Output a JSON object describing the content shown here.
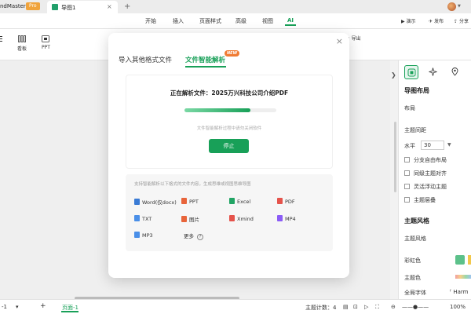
{
  "titlebar": {
    "app_name": "ndMaster",
    "pro_badge": "Pro",
    "doc_tab": "导图1",
    "doc_close": "×",
    "new_tab": "+"
  },
  "menubar": {
    "items": [
      "开始",
      "插入",
      "页面样式",
      "高级",
      "视图",
      "AI"
    ],
    "active": "AI",
    "actions": {
      "present": "演示",
      "publish": "发布",
      "share": "分享"
    }
  },
  "toolbar": {
    "tools": [
      {
        "label": "",
        "icon": "list-icon"
      },
      {
        "label": "看板",
        "icon": "kanban-icon"
      },
      {
        "label": "PPT",
        "icon": "ppt-icon"
      }
    ],
    "extra_label": "导出"
  },
  "modal": {
    "close": "×",
    "tabs": [
      "导入其他格式文件",
      "文件智能解析"
    ],
    "active_tab": "文件智能解析",
    "new_badge": "NEW",
    "parse": {
      "title": "正在解析文件：2025万兴科技公司介绍PDF",
      "progress": 0.72,
      "hint": "文件智能解析过程中请勿关闭软件",
      "stop_label": "停止"
    },
    "formats_note": "支持智能解析以下格式的文件内容，生成思维或视图思维导图",
    "formats": [
      {
        "label": "Word(仅docx)",
        "color": "#3a7bd5"
      },
      {
        "label": "PPT",
        "color": "#e8643a"
      },
      {
        "label": "Excel",
        "color": "#21a464"
      },
      {
        "label": "PDF",
        "color": "#e5534b"
      },
      {
        "label": "TXT",
        "color": "#4a8fe8"
      },
      {
        "label": "图片",
        "color": "#e8643a"
      },
      {
        "label": "Xmind",
        "color": "#e5534b"
      },
      {
        "label": "MP4",
        "color": "#8b5cf6"
      },
      {
        "label": "MP3",
        "color": "#4a8fe8"
      },
      {
        "label": "更多",
        "color": ""
      }
    ],
    "more_help": "?"
  },
  "right_panel": {
    "tabs": [
      "style-icon",
      "sparkle-icon",
      "location-icon"
    ],
    "section_title": "导图布局",
    "layout_label": "布局",
    "spacing_label": "主题间距",
    "horizontal_label": "水平",
    "horizontal_value": "30",
    "checks": [
      "分支自由布局",
      "同级主题对齐",
      "灵活浮动主题",
      "主题层叠"
    ],
    "style_title": "主题风格",
    "theme_style_label": "主题风格",
    "rainbow_label": "彩虹色",
    "theme_color_label": "主题色",
    "global_font_label": "全局字体",
    "global_font_value": "Harm"
  },
  "statusbar": {
    "page_nav": "-1",
    "add_page": "+",
    "current_page": "页面-1",
    "topic_count": "主题计数：4",
    "zoom": "100%"
  },
  "colors": {
    "accent": "#18a058",
    "badge_orange": "#f0a33b",
    "new_badge": "#f07b33"
  }
}
